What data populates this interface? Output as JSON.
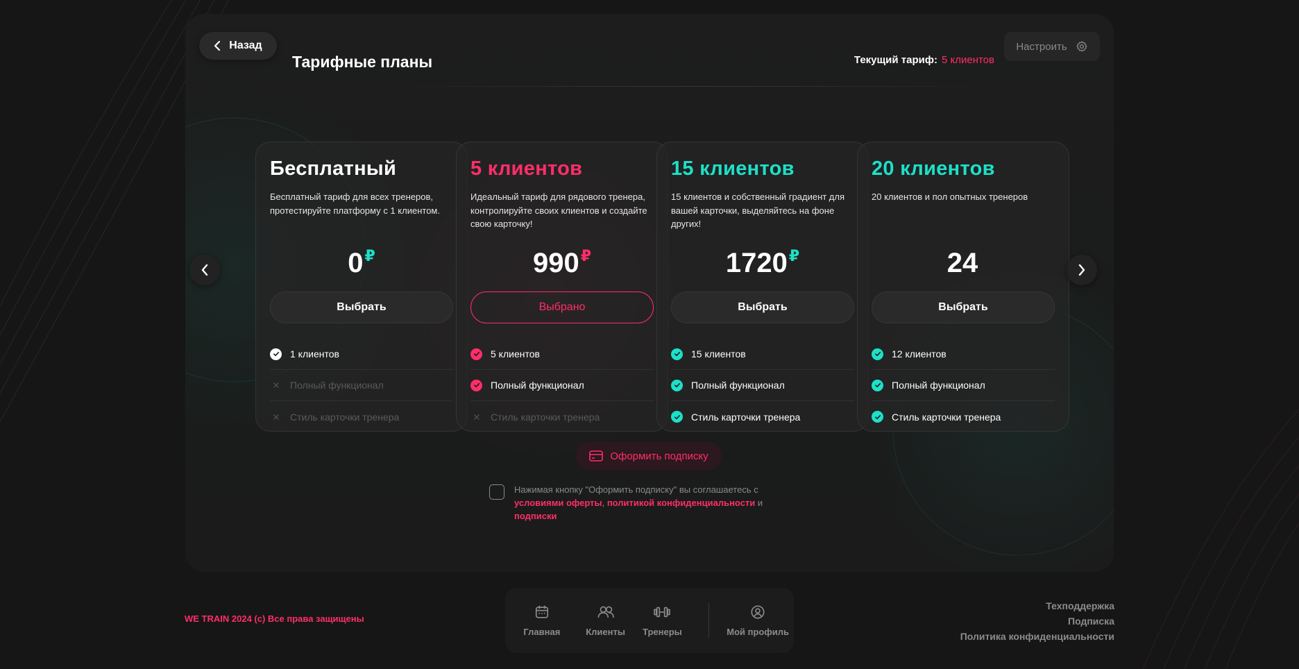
{
  "header": {
    "back_label": "Назад",
    "title": "Тарифные планы",
    "current_plan_label": "Текущий тариф:",
    "current_plan_value": "5 клиентов",
    "setup_label": "Настроить"
  },
  "plans": [
    {
      "title": "Бесплатный",
      "title_color": "#ffffff",
      "accent": "#ffffff",
      "description": "Бесплатный тариф для всех тренеров, протестируйте платформу с 1 клиентом.",
      "price": "0",
      "currency": "₽",
      "button_label": "Выбрать",
      "selected": false,
      "features": [
        {
          "label": "1 клиентов",
          "enabled": true
        },
        {
          "label": "Полный функционал",
          "enabled": false
        },
        {
          "label": "Стиль карточки тренера",
          "enabled": false
        }
      ]
    },
    {
      "title": "5 клиентов",
      "title_color": "#ff2e6a",
      "accent": "#ff2e6a",
      "description": "Идеальный тариф для рядового тренера, контролируйте своих клиентов и создайте свою карточку!",
      "price": "990",
      "currency": "₽",
      "button_label": "Выбрано",
      "selected": true,
      "features": [
        {
          "label": "5 клиентов",
          "enabled": true
        },
        {
          "label": "Полный функционал",
          "enabled": true
        },
        {
          "label": "Стиль карточки тренера",
          "enabled": false
        }
      ]
    },
    {
      "title": "15 клиентов",
      "title_color": "#1de0c8",
      "accent": "#1de0c8",
      "description": "15 клиентов и собственный градиент для вашей карточки, выделяйтесь на фоне других!",
      "price": "1720",
      "currency": "₽",
      "button_label": "Выбрать",
      "selected": false,
      "features": [
        {
          "label": "15 клиентов",
          "enabled": true
        },
        {
          "label": "Полный функционал",
          "enabled": true
        },
        {
          "label": "Стиль карточки тренера",
          "enabled": true
        }
      ]
    },
    {
      "title": "20 клиентов",
      "title_color": "#1de0c8",
      "accent": "#1de0c8",
      "description": "20 клиентов и пол опытных тренеров",
      "price": "24",
      "currency": "",
      "button_label": "Выбрать",
      "selected": false,
      "features": [
        {
          "label": "12 клиентов",
          "enabled": true
        },
        {
          "label": "Полный функционал",
          "enabled": true
        },
        {
          "label": "Стиль карточки тренера",
          "enabled": true
        }
      ]
    }
  ],
  "subscribe": {
    "label": "Оформить подписку",
    "agree_prefix": "Нажимая кнопку \"Оформить подписку\" вы соглашаетесь с",
    "offer_link": "условиями оферты",
    "comma": ",",
    "privacy_link": "политикой конфиденциальности",
    "and": "и",
    "subscription_link": "подписки"
  },
  "footer": {
    "copyright": "WE TRAIN 2024 (c) Все права защищены",
    "nav": [
      {
        "label": "Главная",
        "icon": "calendar-icon"
      },
      {
        "label": "Клиенты",
        "icon": "users-icon"
      },
      {
        "label": "Тренеры",
        "icon": "dumbbell-icon"
      },
      {
        "label": "Мой профиль",
        "icon": "profile-icon"
      }
    ],
    "links": [
      "Техподдержка",
      "Подписка",
      "Политика конфиденциальности"
    ]
  },
  "colors": {
    "accent_pink": "#ff2e6a",
    "accent_teal": "#1de0c8",
    "background": "#161616",
    "panel": "#1d1d1d"
  }
}
